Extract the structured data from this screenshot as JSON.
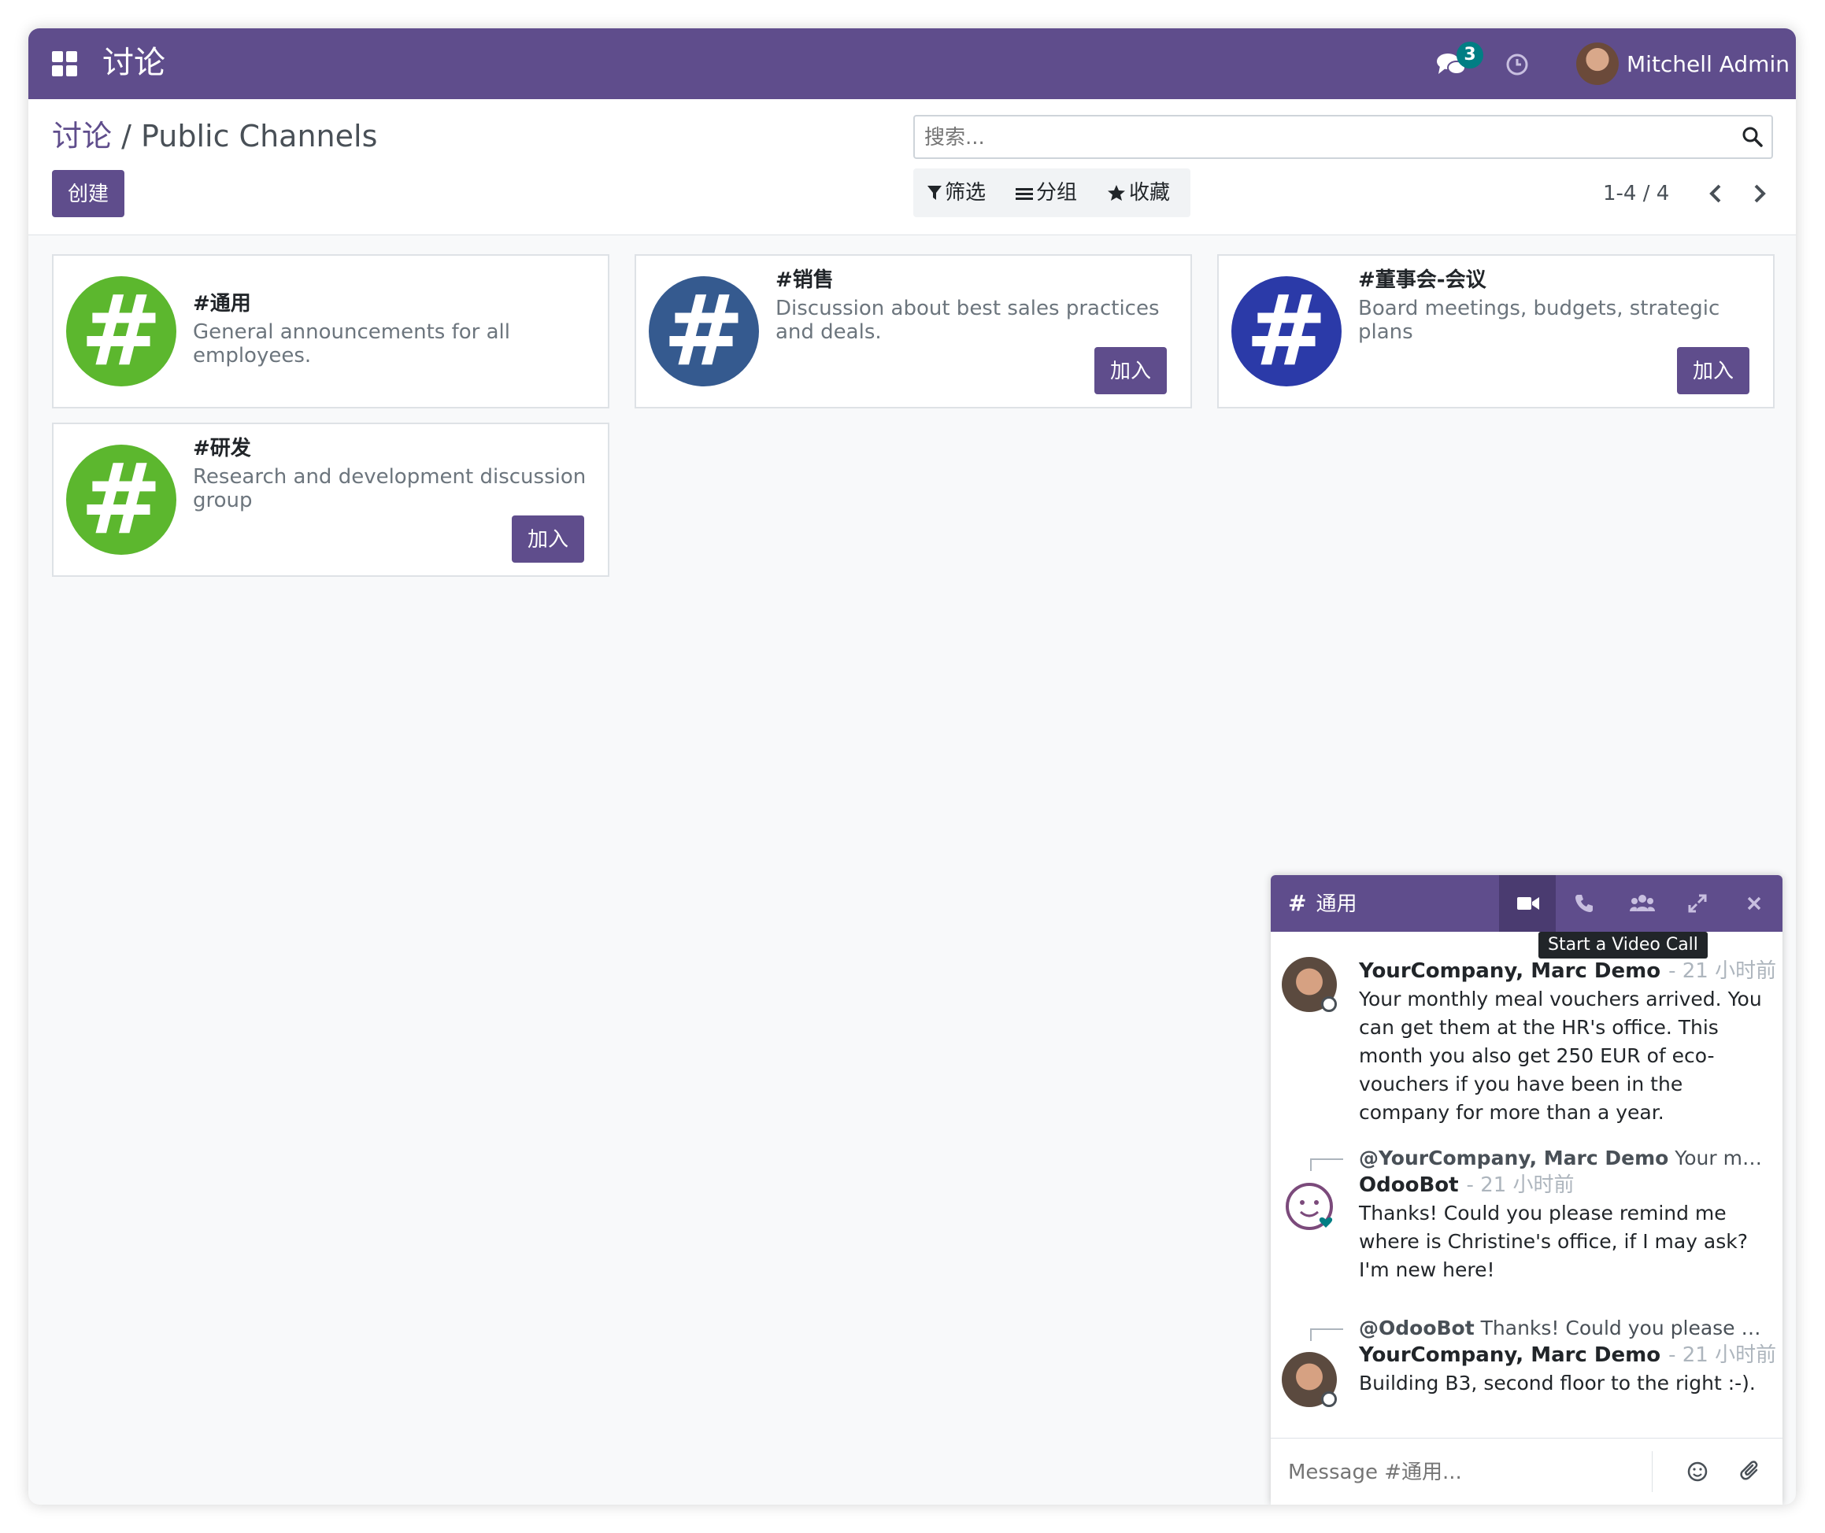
{
  "navbar": {
    "app_title": "讨论",
    "messages_badge": "3",
    "user_name": "Mitchell Admin",
    "icons": [
      "apps-icon",
      "chat-bubbles-icon",
      "clock-icon",
      "avatar"
    ]
  },
  "control_panel": {
    "breadcrumb_parent": "讨论",
    "breadcrumb_separator": "/",
    "breadcrumb_current": "Public Channels",
    "create_label": "创建",
    "search_placeholder": "搜索...",
    "filter_label": "筛选",
    "group_label": "分组",
    "favorite_label": "收藏",
    "pager_value": "1-4 / 4"
  },
  "channels": [
    {
      "name": "#通用",
      "description": "General announcements for all employees.",
      "color": "#5cb72e",
      "join_label": ""
    },
    {
      "name": "#销售",
      "description": "Discussion about best sales practices and deals.",
      "color": "#355a8f",
      "join_label": "加入"
    },
    {
      "name": "#董事会-会议",
      "description": "Board meetings, budgets, strategic plans",
      "color": "#2b3aa8",
      "join_label": "加入"
    },
    {
      "name": "#研发",
      "description": "Research and development discussion group",
      "color": "#5cb72e",
      "join_label": "加入"
    }
  ],
  "channel_glyph": "#",
  "chat_window": {
    "hash": "#",
    "title": "通用",
    "tooltip": "Start a Video Call",
    "messages": [
      {
        "author": "YourCompany, Marc Demo",
        "date": "- 21 小时前",
        "body": "Your monthly meal vouchers arrived. You can get them at the HR's office. This month you also get 250 EUR of eco-vouchers if you have been in the company for more than a year."
      },
      {
        "reply_to_author": "@YourCompany, Marc Demo",
        "reply_to_text": "Your monthl...",
        "author": "OdooBot",
        "date": "- 21 小时前",
        "body": "Thanks! Could you please remind me where is Christine's office, if I may ask? I'm new here!"
      },
      {
        "reply_to_author": "@OdooBot",
        "reply_to_text": "Thanks! Could you please remi...",
        "author": "YourCompany, Marc Demo",
        "date": "- 21 小时前",
        "body": "Building B3, second floor to the right :-)."
      }
    ],
    "composer_placeholder": "Message #通用..."
  },
  "colors": {
    "brand": "#5f4d8c",
    "badge": "#017e84",
    "background": "#f8f9fa"
  }
}
